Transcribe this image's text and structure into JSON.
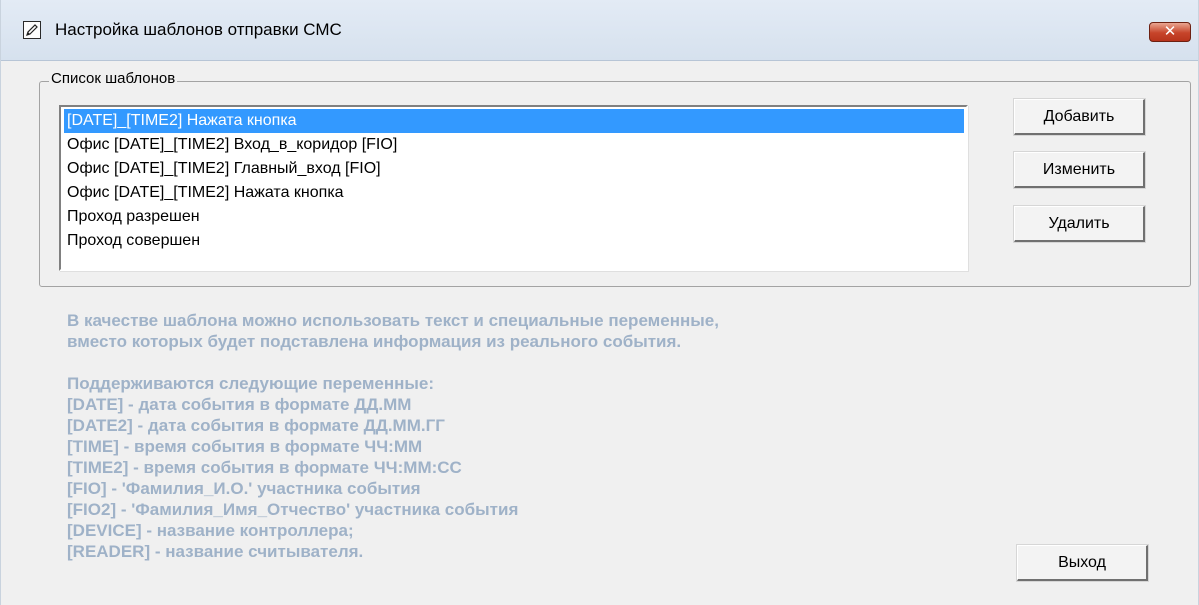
{
  "window": {
    "title": "Настройка шаблонов отправки СМС",
    "close_glyph": "✕",
    "icon": "pencil-icon"
  },
  "group": {
    "legend": "Список шаблонов"
  },
  "templates": [
    "[DATE]_[TIME2] Нажата кнопка",
    "Офис [DATE]_[TIME2] Вход_в_коридор [FIO]",
    "Офис [DATE]_[TIME2] Главный_вход [FIO]",
    "Офис [DATE]_[TIME2] Нажата кнопка",
    "Проход разрешен",
    "Проход совершен"
  ],
  "selected_index": 0,
  "buttons": {
    "add": "Добавить",
    "edit": "Изменить",
    "delete": "Удалить",
    "exit": "Выход"
  },
  "info": {
    "intro": [
      "В качестве шаблона можно использовать текст и специальные переменные,",
      "вместо которых будет подставлена информация из реального события."
    ],
    "vars_header": "Поддерживаются следующие переменные:",
    "vars": [
      "[DATE] - дата события в формате ДД.ММ",
      "[DATE2] - дата события в формате ДД.ММ.ГГ",
      "[TIME] - время события в формате ЧЧ:ММ",
      "[TIME2] - время события в формате ЧЧ:ММ:СС",
      "[FIO] - 'Фамилия_И.О.' участника события",
      "[FIO2] - 'Фамилия_Имя_Отчество' участника события",
      "[DEVICE] - название контроллера;",
      "[READER] - название считывателя."
    ]
  },
  "colors": {
    "selection": "#3399ff",
    "info_text": "#9fb2c8",
    "close_button": "#c7442a"
  }
}
